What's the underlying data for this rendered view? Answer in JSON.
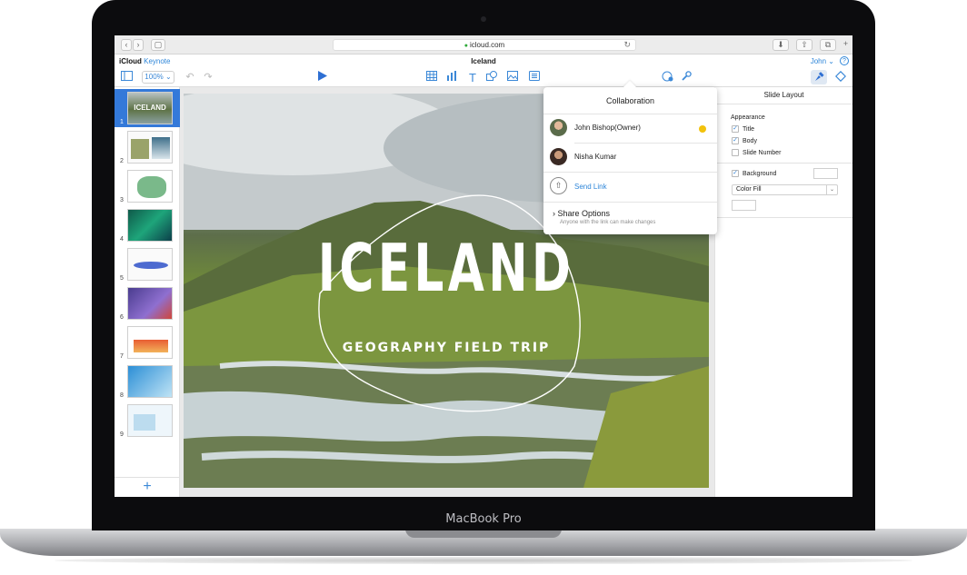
{
  "device": {
    "label": "MacBook Pro"
  },
  "browser": {
    "url": "icloud.com"
  },
  "app": {
    "brand_icloud": "iCloud",
    "brand_app": "Keynote",
    "document_title": "Iceland",
    "user_name": "John",
    "help_glyph": "?"
  },
  "toolbar": {
    "zoom": "100%"
  },
  "navigator": {
    "slides": [
      "1",
      "2",
      "3",
      "4",
      "5",
      "6",
      "7",
      "8",
      "9"
    ],
    "add_glyph": "+"
  },
  "slide": {
    "title": "ICELAND",
    "subtitle": "GEOGRAPHY FIELD TRIP"
  },
  "sidebar": {
    "title": "Slide Layout",
    "appearance_heading": "Appearance",
    "options": [
      {
        "label": "Title",
        "checked": true
      },
      {
        "label": "Body",
        "checked": true
      },
      {
        "label": "Slide Number",
        "checked": false
      }
    ],
    "background_label": "Background",
    "background_checked": true,
    "fill_select": "Color Fill"
  },
  "collaboration": {
    "title": "Collaboration",
    "participants": [
      {
        "name": "John Bishop(Owner)",
        "status_color": "#f2c20c"
      },
      {
        "name": "Nisha Kumar"
      }
    ],
    "send_link": "Send Link",
    "share_options": "Share Options",
    "share_options_sub": "Anyone with the link can make changes"
  }
}
